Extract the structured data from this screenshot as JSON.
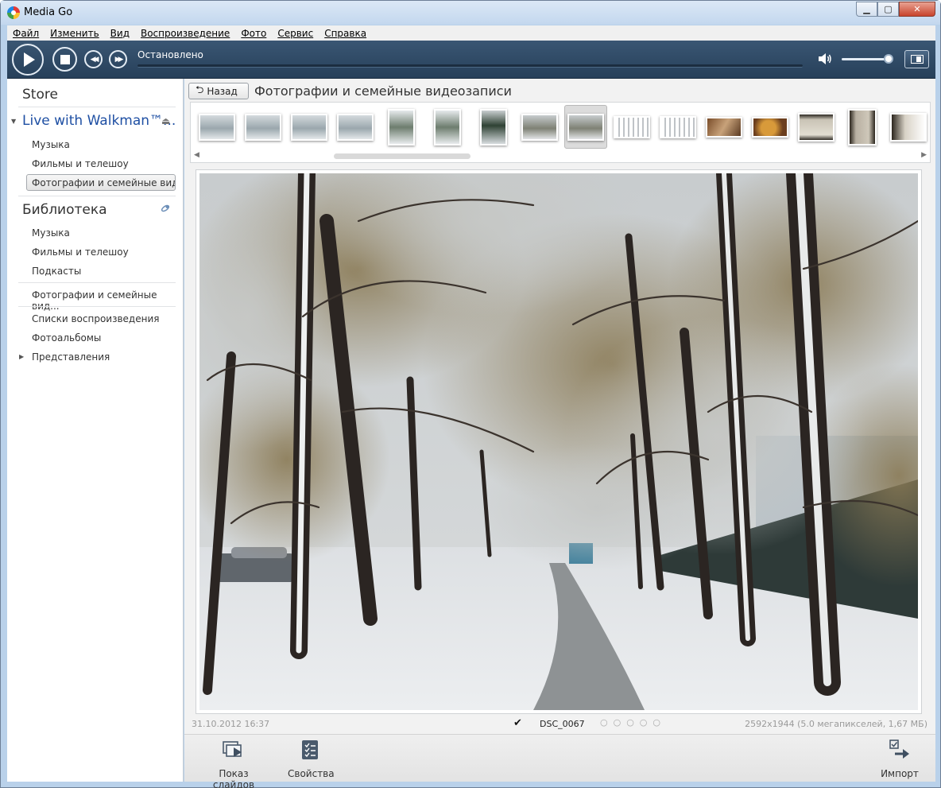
{
  "window": {
    "title": "Media Go"
  },
  "menu": [
    "Файл",
    "Изменить",
    "Вид",
    "Воспроизведение",
    "Фото",
    "Сервис",
    "Справка"
  ],
  "transport": {
    "status": "Остановлено",
    "volume_fraction": 0.9
  },
  "sidebar": {
    "store": "Store",
    "device": {
      "name": "Live with Walkman™...",
      "items": [
        "Музыка",
        "Фильмы и телешоу",
        "Фотографии и семейные вид..."
      ]
    },
    "library": {
      "title": "Библиотека",
      "items": [
        "Музыка",
        "Фильмы и телешоу",
        "Подкасты",
        "Фотографии и семейные вид...",
        "Списки воспроизведения",
        "Фотоальбомы",
        "Представления"
      ]
    }
  },
  "main": {
    "back_label": "Назад",
    "title": "Фотографии и семейные видеозаписи",
    "thumbnails": [
      {
        "kind": "snow-wide"
      },
      {
        "kind": "snow-wide"
      },
      {
        "kind": "snow-wide"
      },
      {
        "kind": "snow-wide"
      },
      {
        "kind": "tree-tall"
      },
      {
        "kind": "tree-tall"
      },
      {
        "kind": "tree-tall-dark"
      },
      {
        "kind": "alley"
      },
      {
        "kind": "alley",
        "selected": true
      },
      {
        "kind": "video"
      },
      {
        "kind": "video"
      },
      {
        "kind": "warm"
      },
      {
        "kind": "teddy"
      },
      {
        "kind": "doc-square"
      },
      {
        "kind": "doc-tall"
      },
      {
        "kind": "doc-fade"
      }
    ]
  },
  "photo_info": {
    "date": "31.10.2012 16:37",
    "filename": "DSC_0067",
    "rating_dots": "○○○○○",
    "details": "2592x1944 (5.0 мегапикселей, 1,67 МБ)"
  },
  "toolbar": {
    "slideshow": "Показ слайдов",
    "properties": "Свойства",
    "import": "Импорт"
  }
}
